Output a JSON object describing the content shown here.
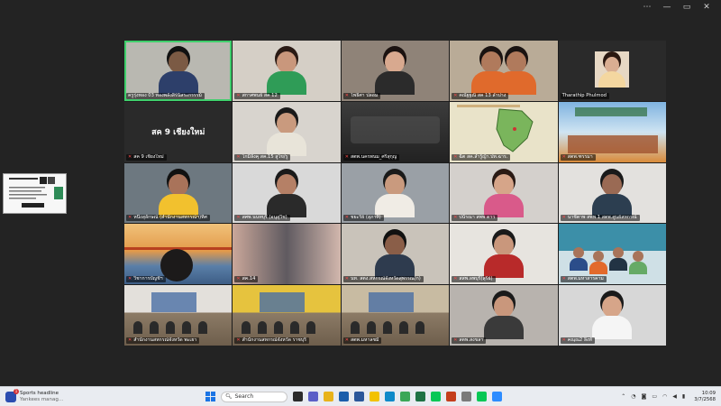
{
  "window": {
    "controls": [
      "⋯",
      "—",
      "▭",
      "✕"
    ]
  },
  "tiles": [
    {
      "name": "ครูรุ่งทอง 03 ทองพลังสิร์นิสระกรรรม์",
      "muted": false,
      "active": true,
      "scene": "person",
      "bg": "#b9b8b1",
      "skin": "#7b5a44",
      "hair": "#111",
      "shirt": "#2d3f6a"
    },
    {
      "name": "สกาศพนธ์ สค 12",
      "muted": true,
      "scene": "person",
      "bg": "#d5cfc6",
      "skin": "#c9977c",
      "hair": "#2a1a14",
      "shirt": "#2f9c57"
    },
    {
      "name": "โพธิศา ปลอม",
      "muted": true,
      "scene": "person",
      "bg": "#8f8378",
      "skin": "#d8a98f",
      "hair": "#1b1210",
      "shirt": "#2b2b2b"
    },
    {
      "name": "คณัฐฐณี สค 13 ลำปาง",
      "muted": true,
      "scene": "person2",
      "bg": "#b9ab97",
      "skin": "#b07a5c",
      "hair": "#1a1311",
      "shirt": "#e06a2c"
    },
    {
      "name": "Tharathip Phulmod",
      "muted": false,
      "scene": "card-photo",
      "bg": "#2a2a2a",
      "skin": "#d9ae92",
      "hair": "#2a1810",
      "shirt": "#f4d7a0"
    },
    {
      "name": "สค 9 เชียงใหม่",
      "muted": true,
      "scene": "text",
      "label": "สค 9 เชียงใหม่",
      "bg": "#2a2a2a"
    },
    {
      "name": "โกมิลังคุ สค.15 สูโข/รู",
      "muted": true,
      "scene": "person",
      "bg": "#d8d4ce",
      "skin": "#c99a7e",
      "hair": "#1a1a1a",
      "shirt": "#e8e4d9"
    },
    {
      "name": "สตพ.นครพนม_ศรีสุกุญ",
      "muted": true,
      "scene": "dark",
      "bg": "#3a3a3a"
    },
    {
      "name": "ฉิต สค.ลำรู้ญ้า.ปท.ฉาร.",
      "muted": true,
      "scene": "map",
      "bg": "#e9e3c9"
    },
    {
      "name": "สตพ.ฑรรมา",
      "muted": true,
      "scene": "poster",
      "bg": "#8bb7d8"
    },
    {
      "name": "หนึ่งสุลักษณ์ (สำนักงานสหกรณ์ฯ)ทิศ",
      "muted": true,
      "scene": "person",
      "bg": "#6d7880",
      "skin": "#a9735a",
      "hair": "#111",
      "shirt": "#f2c12e"
    },
    {
      "name": "สศพ.นนทบุรี (อนุสุวิช)",
      "muted": true,
      "scene": "person",
      "bg": "#d9d9d9",
      "skin": "#b58066",
      "hair": "#1a1a1a",
      "shirt": "#2a2a2a"
    },
    {
      "name": "ชยะรีย์ (สุภาทิ้)",
      "muted": true,
      "scene": "person",
      "bg": "#9aa0a6",
      "skin": "#c99a7e",
      "hair": "#1a1a1a",
      "shirt": "#f0ece5"
    },
    {
      "name": "ปนัรณา สพพ ดาว",
      "muted": true,
      "scene": "person",
      "bg": "#d4d0cc",
      "skin": "#d6a589",
      "hair": "#2a1a14",
      "shirt": "#d95a8a"
    },
    {
      "name": "นาชีตาพ สพพ 1 สตพ.ศูนย์สหกรณ์",
      "muted": true,
      "scene": "person",
      "bg": "#e3e1de",
      "skin": "#9a6a54",
      "hair": "#1a1a1a",
      "shirt": "#2c3e50"
    },
    {
      "name": "วิชาการบัญชีฯ",
      "muted": true,
      "scene": "bridge",
      "bg": "#e0a862"
    },
    {
      "name": "สค.14",
      "muted": true,
      "scene": "blur",
      "bg": "#b3a59e"
    },
    {
      "name": "นท. สตง.สหกรณ์จังหวัดสุพรรณ(ก)",
      "muted": true,
      "scene": "person",
      "bg": "#c9c3ba",
      "skin": "#8a5e48",
      "hair": "#111",
      "shirt": "#2e3b4e"
    },
    {
      "name": "สสพ.ลพบุรี(สุรีย์)",
      "muted": true,
      "scene": "person",
      "bg": "#e7e4df",
      "skin": "#c9977c",
      "hair": "#1a1a1a",
      "shirt": "#b82a2a"
    },
    {
      "name": "สตพ.มหาสารคาม",
      "muted": true,
      "scene": "group",
      "bg": "#cfe0e6"
    },
    {
      "name": "สำนักงานสหกรณ์จังหวัด พะเยา",
      "muted": true,
      "scene": "room",
      "bg": "#d9d5cf"
    },
    {
      "name": "สำนักงานสหกรณ์จังหวัด ราชบุรี",
      "muted": true,
      "scene": "room-yellow",
      "bg": "#e9c94a"
    },
    {
      "name": "สตพ.มหาลชมี",
      "muted": true,
      "scene": "meeting",
      "bg": "#d8d2c4"
    },
    {
      "name": "สตพ.สงขลา",
      "muted": true,
      "scene": "person",
      "bg": "#b8b3ae",
      "skin": "#c9977c",
      "hair": "#1a1a1a",
      "shirt": "#3a3a3a"
    },
    {
      "name": "คณฺณ2 ลิ้งทั",
      "muted": true,
      "scene": "person",
      "bg": "#d7d7d7",
      "skin": "#d6a589",
      "hair": "#1a1a1a",
      "shirt": "#f5f5f5"
    }
  ],
  "taskbar": {
    "news_title": "Sports headline",
    "news_subtitle": "Yankees manag...",
    "news_badge": "1",
    "search_label": "Search",
    "apps": [
      {
        "name": "task-view",
        "color": "#2b2b2b"
      },
      {
        "name": "teams",
        "color": "#5b5fc7"
      },
      {
        "name": "chrome",
        "color": "#e8b31b"
      },
      {
        "name": "word-blue",
        "color": "#1a5dab"
      },
      {
        "name": "word",
        "color": "#2b579a"
      },
      {
        "name": "file-explorer",
        "color": "#f2c200"
      },
      {
        "name": "edge",
        "color": "#0f8ac9"
      },
      {
        "name": "chrome-alt",
        "color": "#3aa757"
      },
      {
        "name": "excel",
        "color": "#1f7244"
      },
      {
        "name": "line",
        "color": "#06c755"
      },
      {
        "name": "powerpoint",
        "color": "#c43e1c"
      },
      {
        "name": "notes",
        "color": "#7a7a7a"
      },
      {
        "name": "line-alt",
        "color": "#06c755"
      },
      {
        "name": "zoom",
        "color": "#2d8cff"
      }
    ],
    "time": "10:09",
    "date": "3/7/2568"
  }
}
